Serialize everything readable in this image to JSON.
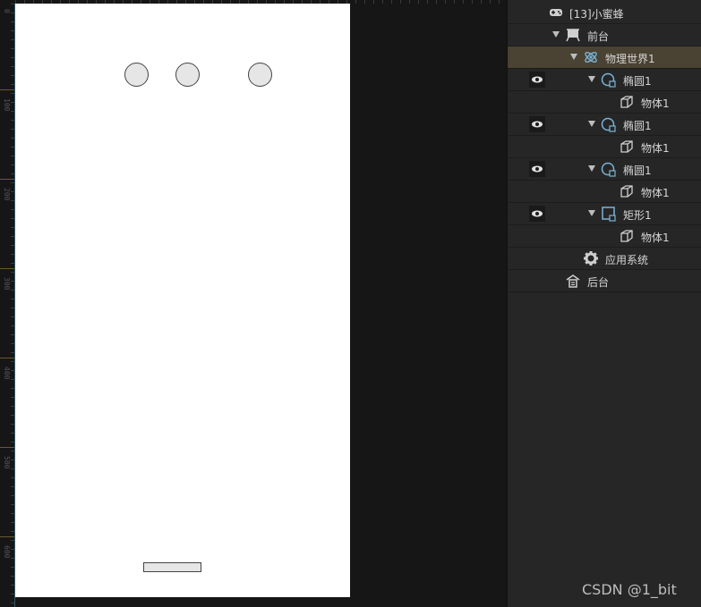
{
  "ruler": {
    "labels": [
      "0",
      "100",
      "200",
      "300",
      "400",
      "500",
      "600"
    ]
  },
  "stage": {
    "background": "#ffffff",
    "shape_fill": "#e6e6e6"
  },
  "tree": {
    "rows": [
      {
        "label": "[13]小蜜蜂",
        "icon": "gamepad-icon"
      },
      {
        "label": "前台",
        "icon": "stage-icon"
      },
      {
        "label": "物理世界1",
        "icon": "physics-world-icon",
        "selected": true
      },
      {
        "label": "椭圆1",
        "icon": "ellipse-icon",
        "visible": true
      },
      {
        "label": "物体1",
        "icon": "body-cube-icon"
      },
      {
        "label": "椭圆1",
        "icon": "ellipse-icon",
        "visible": true
      },
      {
        "label": "物体1",
        "icon": "body-cube-icon"
      },
      {
        "label": "椭圆1",
        "icon": "ellipse-icon",
        "visible": true
      },
      {
        "label": "物体1",
        "icon": "body-cube-icon"
      },
      {
        "label": "矩形1",
        "icon": "rectangle-icon",
        "visible": true
      },
      {
        "label": "物体1",
        "icon": "body-cube-icon"
      },
      {
        "label": "应用系统",
        "icon": "gear-icon"
      },
      {
        "label": "后台",
        "icon": "backstage-icon"
      }
    ]
  },
  "watermark": "CSDN @1_bit"
}
